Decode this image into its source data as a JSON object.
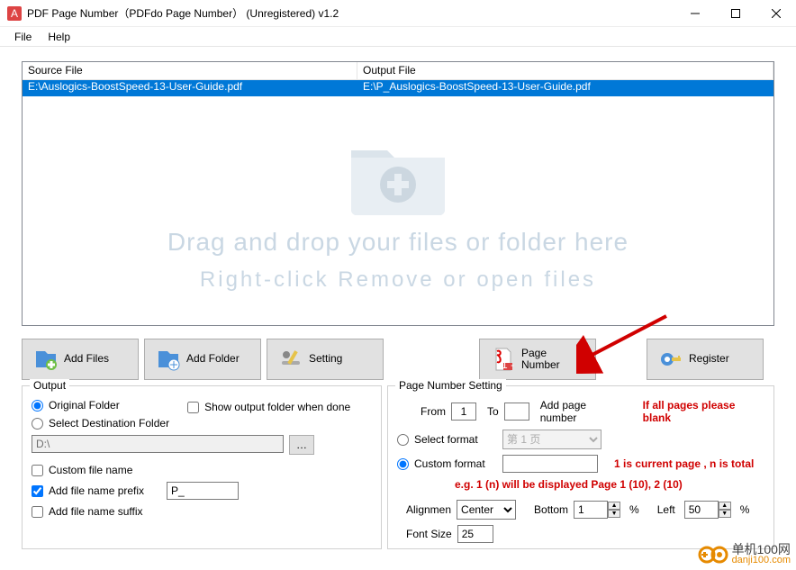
{
  "titlebar": {
    "title": "PDF Page Number（PDFdo Page Number）  (Unregistered) v1.2"
  },
  "menu": {
    "file": "File",
    "help": "Help"
  },
  "file_list": {
    "col_source": "Source File",
    "col_output": "Output File",
    "rows": [
      {
        "src": "E:\\Auslogics-BoostSpeed-13-User-Guide.pdf",
        "out": "E:\\P_Auslogics-BoostSpeed-13-User-Guide.pdf"
      }
    ]
  },
  "drop_hint": {
    "line1": "Drag and drop your files or folder here",
    "line2": "Right-click Remove or open files"
  },
  "buttons": {
    "add_files": "Add Files",
    "add_folder": "Add Folder",
    "setting": "Setting",
    "page_number": "Page\nNumber",
    "register": "Register"
  },
  "output": {
    "legend": "Output",
    "original_folder": "Original Folder",
    "select_dest": "Select Destination Folder",
    "show_output": "Show output folder when done",
    "dest_path": "D:\\",
    "custom_file_name": "Custom file name",
    "add_prefix": "Add file name prefix",
    "add_suffix": "Add file name suffix",
    "prefix_value": "P_"
  },
  "page_number": {
    "legend": "Page Number Setting",
    "from_label": "From",
    "from_value": "1",
    "to_label": "To",
    "to_value": "",
    "add_pn_label": "Add page number",
    "hint_blank": "If all pages please blank",
    "select_format": "Select format",
    "select_format_value": "第 1 页",
    "custom_format": "Custom format",
    "custom_format_value": "",
    "hint_custom": "1 is current page , n is total",
    "example": "e.g.  1 (n) will be displayed Page 1 (10), 2 (10)",
    "alignment_label": "Alignmen",
    "alignment_value": "Center",
    "bottom_label": "Bottom",
    "bottom_value": "1",
    "left_label": "Left",
    "left_value": "50",
    "percent": "%",
    "font_size_label": "Font Size",
    "font_size_value": "25"
  },
  "watermark": {
    "cn": "单机100网",
    "url": "danji100.com"
  }
}
